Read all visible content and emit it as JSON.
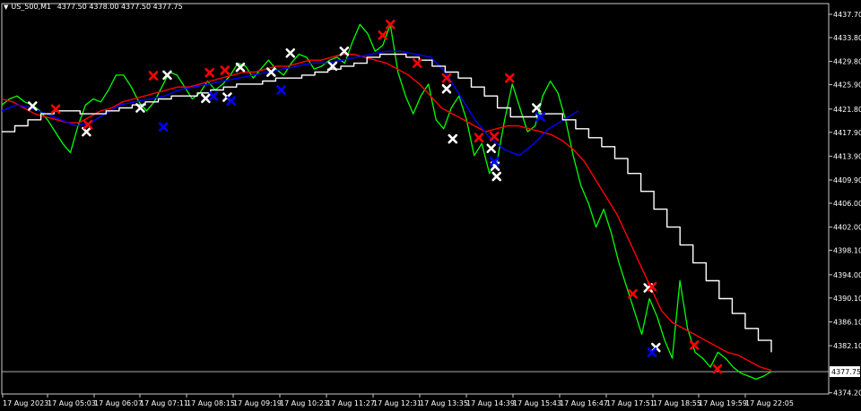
{
  "chart_data": {
    "type": "line",
    "title": "US_500,M1",
    "ohlc": [
      "4377.50",
      "4378.00",
      "4377.50",
      "4377.75"
    ],
    "ylim": [
      4374.0,
      4439.5
    ],
    "y_ticks": [
      "4437.70",
      "4433.80",
      "4429.80",
      "4425.90",
      "4421.80",
      "4417.90",
      "4413.90",
      "4409.90",
      "4406.00",
      "4402.00",
      "4398.10",
      "4394.00",
      "4390.10",
      "4386.10",
      "4382.10",
      "4374.20"
    ],
    "current_price_label": "4377.75",
    "current_price": 4377.75,
    "x_ticks": [
      "17 Aug 2023",
      "17 Aug 05:03",
      "17 Aug 06:07",
      "17 Aug 07:11",
      "17 Aug 08:15",
      "17 Aug 09:19",
      "17 Aug 10:23",
      "17 Aug 11:27",
      "17 Aug 12:31",
      "17 Aug 13:35",
      "17 Aug 14:39",
      "17 Aug 15:43",
      "17 Aug 16:47",
      "17 Aug 17:51",
      "17 Aug 18:55",
      "17 Aug 19:59",
      "17 Aug 22:05"
    ],
    "grid": false,
    "series": [
      {
        "color": "#00ff00",
        "values": [
          4422.5,
          4423.5,
          4424.0,
          4423.0,
          4422.5,
          4421.5,
          4420.0,
          4418.0,
          4416.0,
          4414.5,
          4419.0,
          4422.5,
          4423.5,
          4423.0,
          4425.0,
          4427.5,
          4427.5,
          4425.5,
          4423.0,
          4421.5,
          4423.0,
          4425.5,
          4428.0,
          4427.5,
          4425.5,
          4423.5,
          4424.5,
          4426.5,
          4425.0,
          4426.0,
          4427.5,
          4429.5,
          4429.0,
          4427.0,
          4428.5,
          4430.0,
          4428.5,
          4427.5,
          4429.5,
          4431.0,
          4430.5,
          4428.5,
          4429.0,
          4430.0,
          4430.5,
          4429.5,
          4433.0,
          4436.0,
          4434.5,
          4431.5,
          4432.5,
          4436.0,
          4428.0,
          4424.0,
          4421.0,
          4424.0,
          4426.0,
          4420.0,
          4418.5,
          4422.0,
          4424.0,
          4420.0,
          4414.0,
          4416.0,
          4411.0,
          4413.0,
          4420.0,
          4426.0,
          4422.0,
          4418.0,
          4419.0,
          4424.0,
          4426.5,
          4424.5,
          4420.0,
          4414.0,
          4409.0,
          4406.0,
          4402.0,
          4405.0,
          4401.0,
          4396.0,
          4392.0,
          4388.0,
          4384.0,
          4390.0,
          4387.0,
          4383.0,
          4380.0,
          4393.0,
          4385.0,
          4381.0,
          4380.0,
          4378.5,
          4381.0,
          4380.0,
          4378.5,
          4377.5,
          4377.0,
          4376.5,
          4377.0,
          4377.75
        ]
      },
      {
        "color": "#ff0000",
        "values": [
          4423.5,
          4423.0,
          4422.0,
          4421.0,
          4420.5,
          4420.0,
          4419.5,
          4419.5,
          4420.5,
          4421.5,
          4422.0,
          4423.0,
          4423.5,
          4424.0,
          4424.5,
          4425.0,
          4425.5,
          4425.5,
          4426.0,
          4426.5,
          4427.0,
          4427.5,
          4428.0,
          4428.0,
          4428.5,
          4429.0,
          4429.0,
          4429.5,
          4430.0,
          4430.0,
          4430.5,
          4431.0,
          4431.0,
          4430.5,
          4430.0,
          4429.5,
          4428.5,
          4427.5,
          4426.0,
          4424.0,
          4422.0,
          4421.0,
          4420.0,
          4419.0,
          4418.0,
          4418.5,
          4419.0,
          4419.0,
          4418.5,
          4418.0,
          4417.5,
          4416.5,
          4415.0,
          4413.0,
          4410.0,
          4407.0,
          4404.0,
          4400.0,
          4396.0,
          4392.0,
          4388.0,
          4386.0,
          4385.0,
          4384.0,
          4383.0,
          4382.0,
          4381.0,
          4380.5,
          4379.5,
          4378.5,
          4378.0
        ]
      },
      {
        "color": "#0000ff",
        "values": [
          4421.5,
          4422.5,
          4422.0,
          4421.0,
          4420.0,
          4419.0,
          4419.5,
          4421.0,
          4422.5,
          4423.0,
          4423.5,
          4424.0,
          4425.0,
          4425.5,
          4426.0,
          4426.5,
          4427.0,
          4427.5,
          4428.0,
          4428.5,
          4429.0,
          4429.5,
          4429.5,
          4430.0,
          4430.5,
          4431.0,
          4431.5,
          4431.5,
          4431.0,
          4430.5,
          4428.0,
          4424.0,
          4420.0,
          4417.0,
          4415.0,
          4414.0,
          4416.0,
          4418.5,
          4420.0,
          4421.5
        ]
      },
      {
        "color": "#ffffff",
        "values": [
          4418.0,
          4419.0,
          4420.0,
          4421.0,
          4421.5,
          4421.5,
          4421.0,
          4421.0,
          4421.5,
          4422.0,
          4422.5,
          4423.0,
          4423.5,
          4424.0,
          4424.0,
          4424.5,
          4425.0,
          4425.5,
          4426.0,
          4426.0,
          4426.5,
          4427.0,
          4427.0,
          4427.5,
          4428.0,
          4428.5,
          4429.0,
          4429.5,
          4430.5,
          4431.0,
          4431.0,
          4430.5,
          4430.0,
          4429.0,
          4428.0,
          4427.0,
          4425.5,
          4424.0,
          4422.0,
          4420.5,
          4420.5,
          4421.0,
          4421.0,
          4420.0,
          4418.5,
          4417.0,
          4415.5,
          4413.5,
          4411.0,
          4408.0,
          4405.0,
          4402.0,
          4399.0,
          4396.0,
          4393.0,
          4390.0,
          4387.5,
          4385.0,
          4383.0,
          4381.0
        ]
      }
    ],
    "markers": [
      {
        "color": "#ffffff",
        "i": 0.04,
        "y": 4422.3
      },
      {
        "color": "#ffffff",
        "i": 0.11,
        "y": 4418.0
      },
      {
        "color": "#ffffff",
        "i": 0.18,
        "y": 4422.0
      },
      {
        "color": "#ffffff",
        "i": 0.215,
        "y": 4427.5
      },
      {
        "color": "#ffffff",
        "i": 0.265,
        "y": 4423.6
      },
      {
        "color": "#ffffff",
        "i": 0.293,
        "y": 4423.8
      },
      {
        "color": "#ffffff",
        "i": 0.31,
        "y": 4428.8
      },
      {
        "color": "#ffffff",
        "i": 0.35,
        "y": 4428.0
      },
      {
        "color": "#ffffff",
        "i": 0.375,
        "y": 4431.2
      },
      {
        "color": "#ffffff",
        "i": 0.43,
        "y": 4429.0
      },
      {
        "color": "#ffffff",
        "i": 0.445,
        "y": 4431.5
      },
      {
        "color": "#ffffff",
        "i": 0.578,
        "y": 4425.2
      },
      {
        "color": "#ffffff",
        "i": 0.586,
        "y": 4416.8
      },
      {
        "color": "#ffffff",
        "i": 0.636,
        "y": 4415.2
      },
      {
        "color": "#ffffff",
        "i": 0.641,
        "y": 4412.2
      },
      {
        "color": "#ffffff",
        "i": 0.643,
        "y": 4410.5
      },
      {
        "color": "#ffffff",
        "i": 0.695,
        "y": 4422.0
      },
      {
        "color": "#ffffff",
        "i": 0.84,
        "y": 4391.8
      },
      {
        "color": "#ffffff",
        "i": 0.85,
        "y": 4381.8
      },
      {
        "color": "#ff0000",
        "i": 0.07,
        "y": 4421.8
      },
      {
        "color": "#ff0000",
        "i": 0.112,
        "y": 4419.2
      },
      {
        "color": "#ff0000",
        "i": 0.197,
        "y": 4427.4
      },
      {
        "color": "#ff0000",
        "i": 0.27,
        "y": 4427.9
      },
      {
        "color": "#ff0000",
        "i": 0.29,
        "y": 4428.3
      },
      {
        "color": "#ff0000",
        "i": 0.495,
        "y": 4434.2
      },
      {
        "color": "#ff0000",
        "i": 0.505,
        "y": 4436.0
      },
      {
        "color": "#ff0000",
        "i": 0.54,
        "y": 4429.5
      },
      {
        "color": "#ff0000",
        "i": 0.578,
        "y": 4427.0
      },
      {
        "color": "#ff0000",
        "i": 0.62,
        "y": 4417.0
      },
      {
        "color": "#ff0000",
        "i": 0.64,
        "y": 4417.2
      },
      {
        "color": "#ff0000",
        "i": 0.66,
        "y": 4427.0
      },
      {
        "color": "#ff0000",
        "i": 0.82,
        "y": 4390.8
      },
      {
        "color": "#ff0000",
        "i": 0.845,
        "y": 4392.0
      },
      {
        "color": "#ff0000",
        "i": 0.9,
        "y": 4382.2
      },
      {
        "color": "#ff0000",
        "i": 0.93,
        "y": 4378.2
      },
      {
        "color": "#0000ff",
        "i": 0.21,
        "y": 4418.8
      },
      {
        "color": "#0000ff",
        "i": 0.275,
        "y": 4424.0
      },
      {
        "color": "#0000ff",
        "i": 0.298,
        "y": 4423.2
      },
      {
        "color": "#0000ff",
        "i": 0.363,
        "y": 4425.0
      },
      {
        "color": "#0000ff",
        "i": 0.64,
        "y": 4413.0
      },
      {
        "color": "#0000ff",
        "i": 0.7,
        "y": 4420.5
      },
      {
        "color": "#0000ff",
        "i": 0.845,
        "y": 4381.0
      }
    ]
  }
}
